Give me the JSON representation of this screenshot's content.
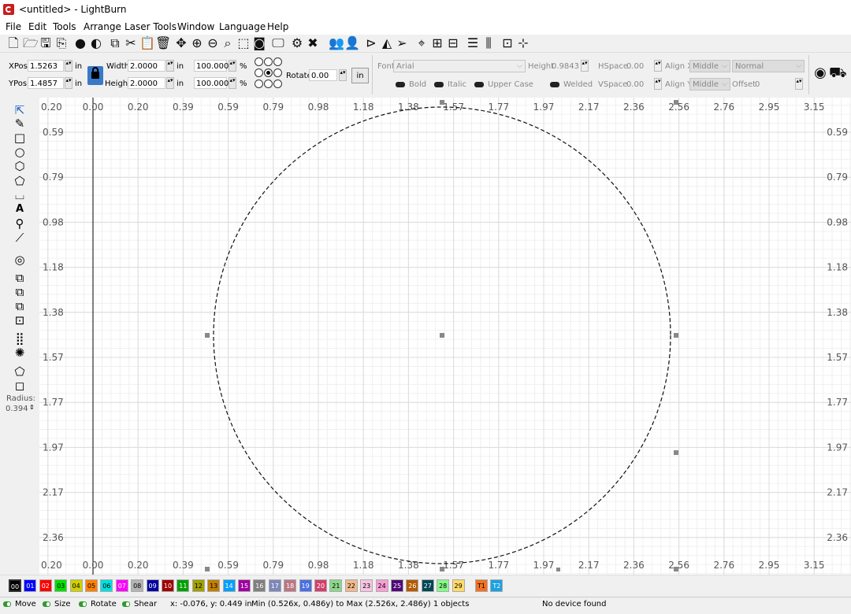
{
  "window": {
    "title": "<untitled> - LightBurn"
  },
  "menu": [
    "File",
    "Edit",
    "Tools",
    "Arrange",
    "Laser Tools",
    "Window",
    "Language",
    "Help"
  ],
  "toolbar_icons": [
    "new-file-icon",
    "open-icon",
    "save-icon",
    "export-icon",
    "import-icon",
    "camera-icon",
    "copy-icon",
    "cut-icon",
    "paste-icon",
    "delete-icon",
    "move-icon",
    "zoom-in-icon",
    "zoom-out-icon",
    "zoom-frame-icon",
    "zoom-fit-icon",
    "camera-capture-icon",
    "monitor-icon",
    "settings-icon",
    "tools-icon",
    "group-icon",
    "user-icon",
    "mirror-icon",
    "flip-icon",
    "send-icon",
    "target-icon",
    "align-icon",
    "align-h-icon",
    "distribute-icon",
    "distribute-v-icon",
    "array-icon",
    "center-icon"
  ],
  "props": {
    "xpos_label": "XPos",
    "xpos_value": "1.5263",
    "xpos_unit": "in",
    "ypos_label": "YPos",
    "ypos_value": "1.4857",
    "ypos_unit": "in",
    "width_label": "Width",
    "width_value": "2.0000",
    "width_unit": "in",
    "height_label": "Height",
    "height_value": "2.0000",
    "height_unit": "in",
    "wpct": "100.000",
    "hpct": "100.000",
    "pct_unit": "%",
    "rotate_label": "Rotate",
    "rotate_value": "0.00",
    "in_button": "in"
  },
  "text": {
    "font_label": "Font",
    "font_value": "Arial",
    "height_label": "Height",
    "height_value": "0.9843",
    "hspace_label": "HSpace",
    "hspace_value": "0.00",
    "vspace_label": "VSpace",
    "vspace_value": "0.00",
    "alignx_label": "Align X",
    "alignx_value": "Middle",
    "aligny_label": "Align Y",
    "aligny_value": "Middle",
    "style_value": "Normal",
    "offset_label": "Offset",
    "offset_value": "0",
    "bold": "Bold",
    "italic": "Italic",
    "upper": "Upper Case",
    "welded": "Welded"
  },
  "left_tools": [
    "select-icon",
    "draw-lines-icon",
    "rectangle-icon",
    "ellipse-icon",
    "polygon-icon",
    "pentagon-icon",
    "frame-icon",
    "text-icon",
    "position-pin-icon",
    "measure-icon",
    "offset-icon",
    "boolean-union-icon",
    "boolean-subtract-icon",
    "boolean-intersect-icon",
    "weld-icon",
    "grid-array-icon",
    "circular-array-icon",
    "node-edit-icon",
    "corner-round-icon"
  ],
  "radius": {
    "label": "Radius:",
    "value": "0.394"
  },
  "ruler": {
    "top_labels": [
      "0.20",
      "0.00",
      "0.20",
      "0.39",
      "0.59",
      "0.79",
      "0.98",
      "1.18",
      "1.38",
      "1.57",
      "1.77",
      "1.97",
      "2.17",
      "2.36",
      "2.56",
      "2.76",
      "2.95",
      "3.15"
    ],
    "side_labels": [
      "0.59",
      "0.79",
      "0.98",
      "1.18",
      "1.38",
      "1.57",
      "1.77",
      "1.97",
      "2.17",
      "2.36"
    ],
    "corner_top": "0.20",
    "corner_bottom": "0.20"
  },
  "palette": [
    {
      "label": "00",
      "color": "#000000",
      "fg": "#ffffff"
    },
    {
      "label": "01",
      "color": "#0000ff",
      "fg": "#ffffff"
    },
    {
      "label": "02",
      "color": "#ff0000",
      "fg": "#ffffff"
    },
    {
      "label": "03",
      "color": "#00e000",
      "fg": "#000000"
    },
    {
      "label": "04",
      "color": "#d0d000",
      "fg": "#000000"
    },
    {
      "label": "05",
      "color": "#ff8000",
      "fg": "#000000"
    },
    {
      "label": "06",
      "color": "#00e0e0",
      "fg": "#000000"
    },
    {
      "label": "07",
      "color": "#ff00ff",
      "fg": "#ffffff"
    },
    {
      "label": "08",
      "color": "#b4b4b4",
      "fg": "#000000"
    },
    {
      "label": "09",
      "color": "#0000a0",
      "fg": "#ffffff"
    },
    {
      "label": "10",
      "color": "#a00000",
      "fg": "#ffffff"
    },
    {
      "label": "11",
      "color": "#00a000",
      "fg": "#ffffff"
    },
    {
      "label": "12",
      "color": "#a0a000",
      "fg": "#000000"
    },
    {
      "label": "13",
      "color": "#c08000",
      "fg": "#000000"
    },
    {
      "label": "14",
      "color": "#00a0ff",
      "fg": "#ffffff"
    },
    {
      "label": "15",
      "color": "#a000a0",
      "fg": "#ffffff"
    },
    {
      "label": "16",
      "color": "#808080",
      "fg": "#ffffff"
    },
    {
      "label": "17",
      "color": "#7d87b9",
      "fg": "#ffffff"
    },
    {
      "label": "18",
      "color": "#bb7784",
      "fg": "#ffffff"
    },
    {
      "label": "19",
      "color": "#4a6fe3",
      "fg": "#ffffff"
    },
    {
      "label": "20",
      "color": "#d33f6a",
      "fg": "#ffffff"
    },
    {
      "label": "21",
      "color": "#8cd78c",
      "fg": "#000000"
    },
    {
      "label": "22",
      "color": "#f0b98d",
      "fg": "#000000"
    },
    {
      "label": "23",
      "color": "#f6c4e1",
      "fg": "#000000"
    },
    {
      "label": "24",
      "color": "#fa9ed4",
      "fg": "#000000"
    },
    {
      "label": "25",
      "color": "#500a78",
      "fg": "#ffffff"
    },
    {
      "label": "26",
      "color": "#b45a00",
      "fg": "#ffffff"
    },
    {
      "label": "27",
      "color": "#004754",
      "fg": "#ffffff"
    },
    {
      "label": "28",
      "color": "#86fa88",
      "fg": "#000000"
    },
    {
      "label": "29",
      "color": "#ffdb66",
      "fg": "#000000"
    },
    {
      "label": "T1",
      "color": "#f37021",
      "fg": "#000000"
    },
    {
      "label": "T2",
      "color": "#1ba1e2",
      "fg": "#ffffff"
    }
  ],
  "status": {
    "move": "Move",
    "size": "Size",
    "rotate": "Rotate",
    "shear": "Shear",
    "coords": "x: -0.076, y: 0.449 in",
    "bounds": "Min (0.526x, 0.486y) to Max (2.526x, 2.486y)  1 objects",
    "device": "No device found"
  }
}
